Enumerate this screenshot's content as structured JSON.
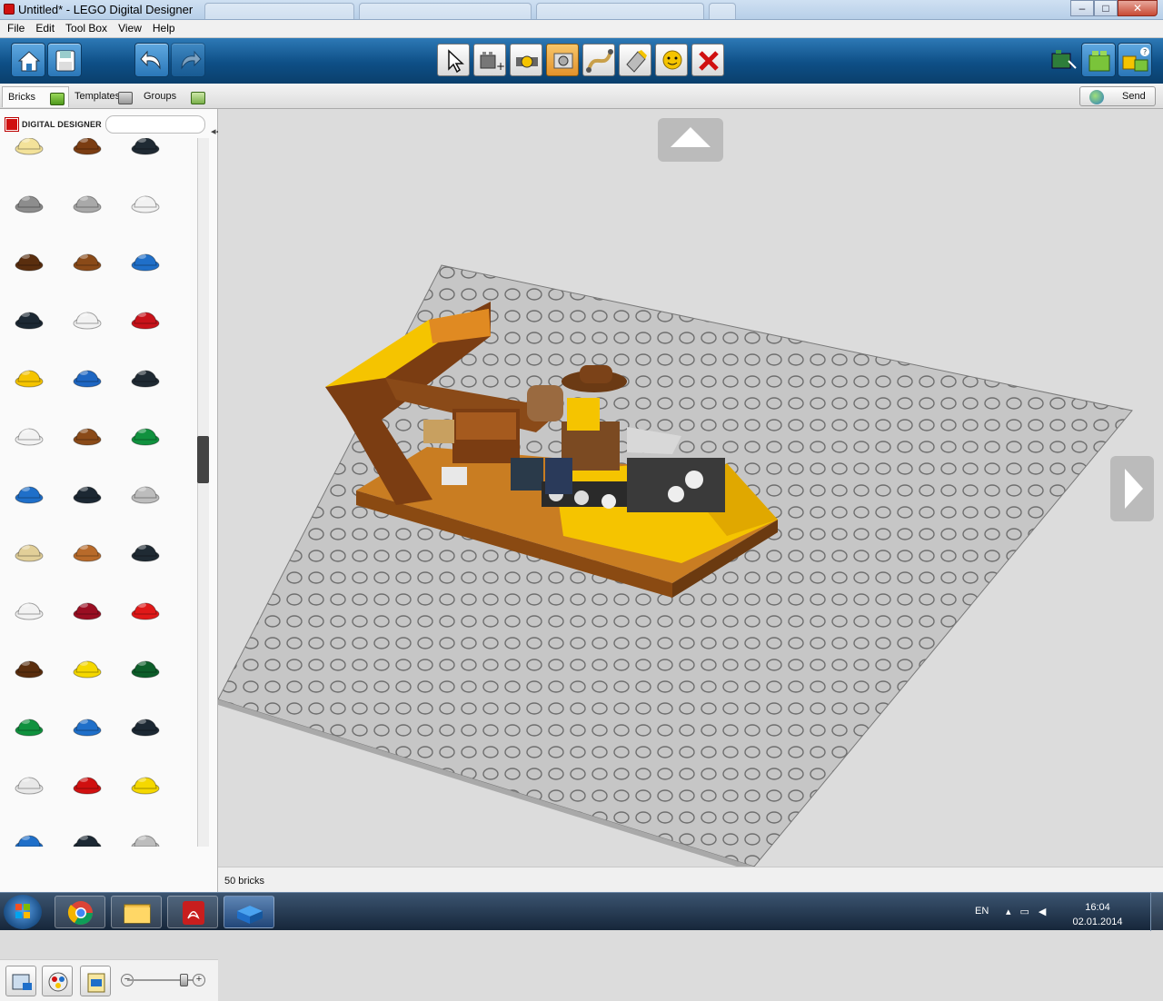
{
  "window": {
    "title": "Untitled* - LEGO Digital Designer",
    "min": "–",
    "max": "□",
    "close": "✕"
  },
  "menu": [
    "File",
    "Edit",
    "Tool Box",
    "View",
    "Help"
  ],
  "tabs": {
    "bricks": "Bricks",
    "templates": "Templates",
    "groups": "Groups"
  },
  "send": "Send",
  "brand": "DIGITAL DESIGNER",
  "search": {
    "placeholder": "",
    "value": ""
  },
  "status": {
    "brick_count": "50 bricks"
  },
  "clock": {
    "time": "16:04",
    "date": "02.01.2014"
  },
  "language": "EN",
  "tools": [
    "select-icon",
    "clone-icon",
    "hinge-icon",
    "hinge-align-icon",
    "flex-icon",
    "paint-icon",
    "hide-icon",
    "delete-icon"
  ],
  "palette_colors": [
    [
      "#f3e29a",
      "#7b3d12",
      "#1f2a33"
    ],
    [
      "#8d8d8d",
      "#a9a9a9",
      "#f2f2f2"
    ],
    [
      "#5a2e0e",
      "#8a4a18",
      "#1f6fc9"
    ],
    [
      "#1c2833",
      "#f2f2f2",
      "#c8121a"
    ],
    [
      "#f5c400",
      "#1e66c2",
      "#1f2a33"
    ],
    [
      "#f2f2f2",
      "#8a4a18",
      "#10913e"
    ],
    [
      "#1f6fc9",
      "#1c2833",
      "#bdbdbd"
    ],
    [
      "#e2cf98",
      "#b86a2a",
      "#1f2a33"
    ],
    [
      "#f2f2f2",
      "#9a0e22",
      "#e01818"
    ],
    [
      "#5a2e0e",
      "#f5d800",
      "#0d5e2a"
    ],
    [
      "#10913e",
      "#1f6fc9",
      "#1c2833"
    ],
    [
      "#e8e8e8",
      "#d01010",
      "#f5d800"
    ],
    [
      "#1f6fc9",
      "#1c2833",
      "#bdbdbd"
    ]
  ]
}
